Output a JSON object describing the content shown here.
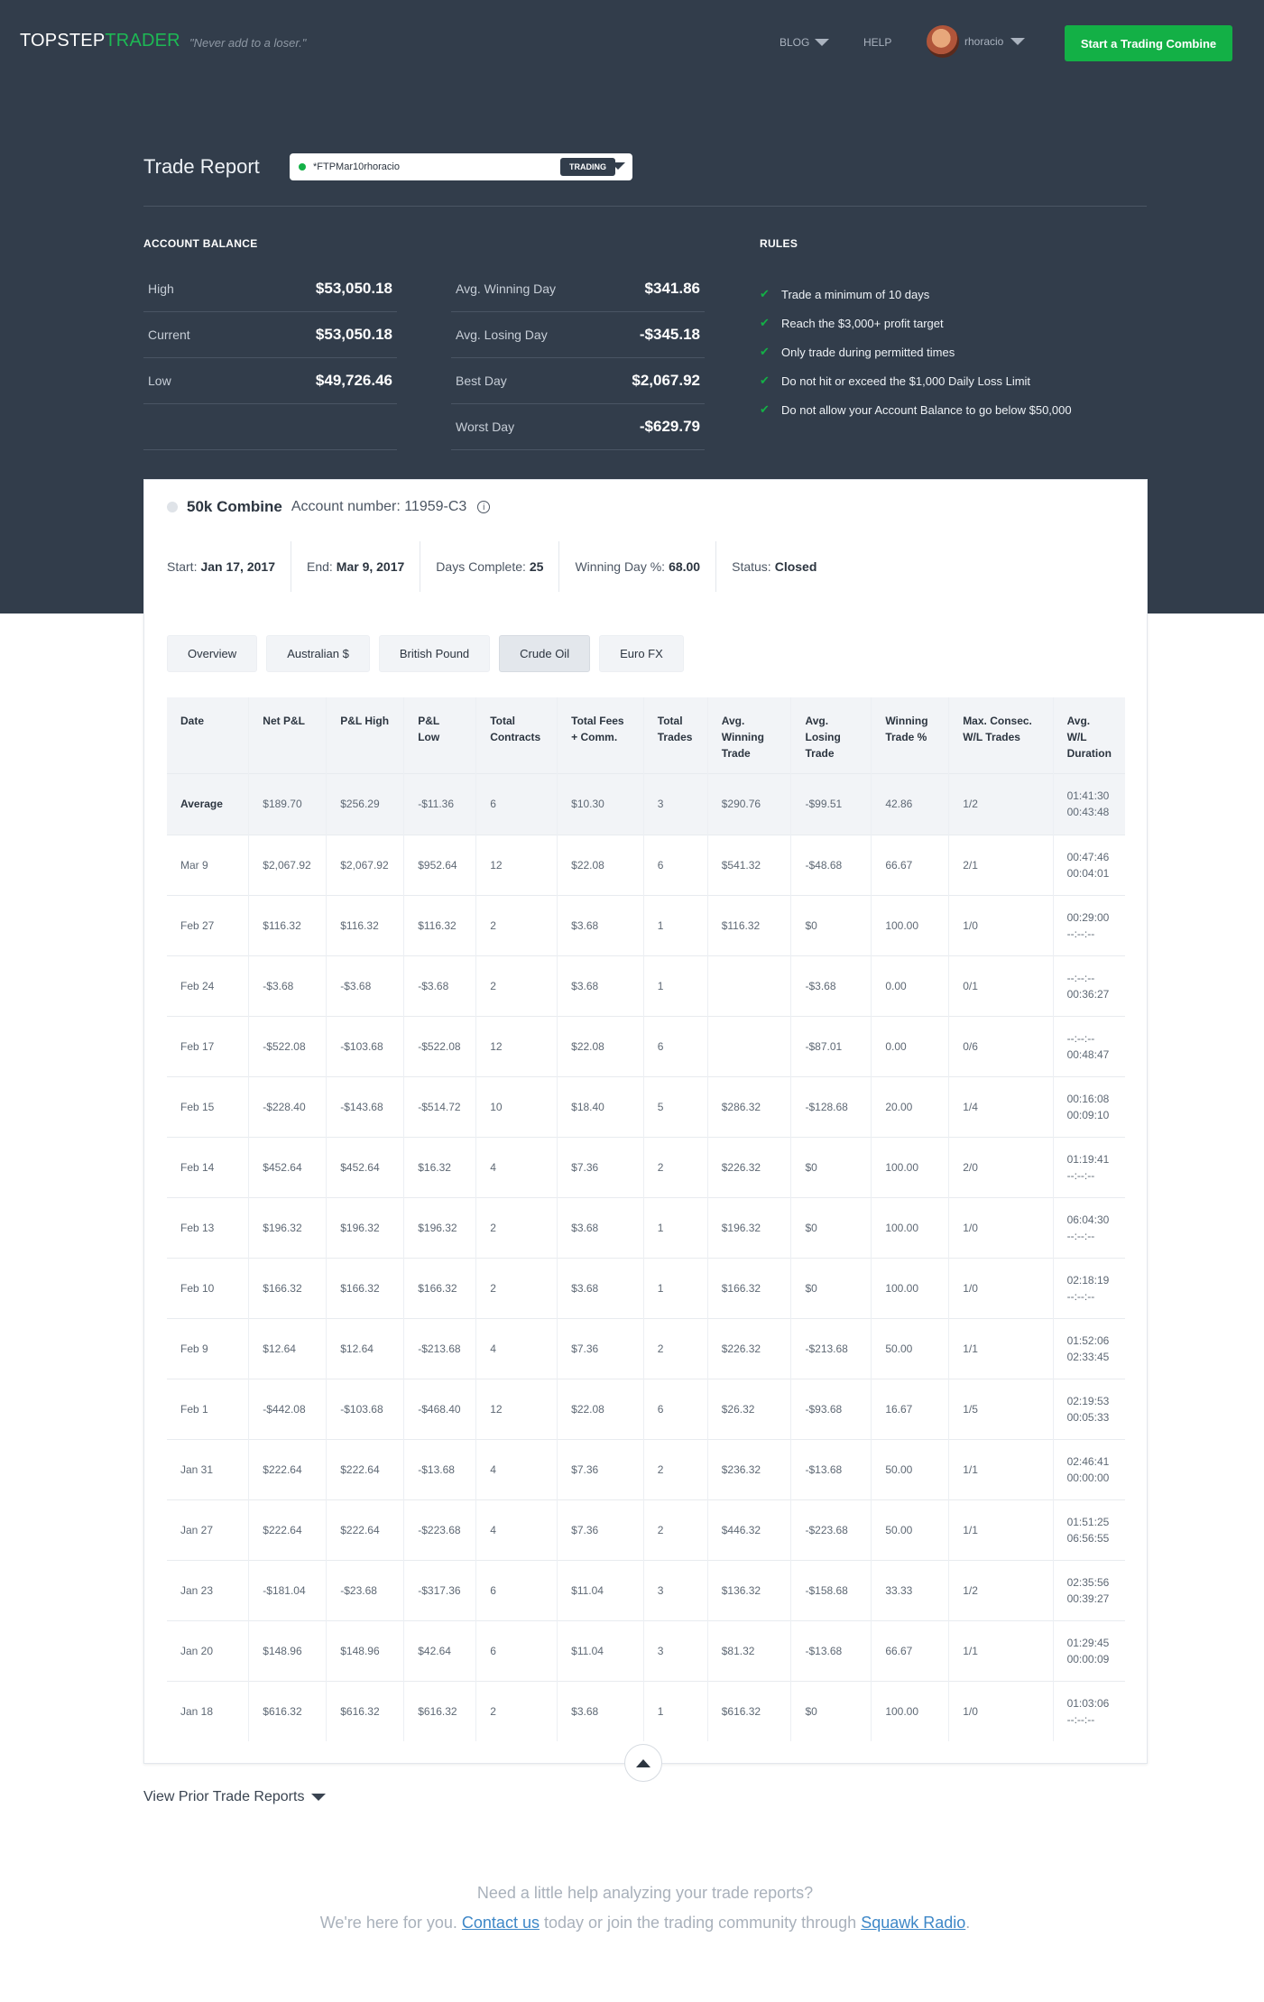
{
  "header": {
    "logo_part1": "TOPSTEP",
    "logo_part2": "TRADER",
    "tagline": "\"Never add to a loser.\"",
    "nav_blog": "BLOG",
    "nav_help": "HELP",
    "username": "rhoracio",
    "cta_label": "Start a Trading Combine"
  },
  "report": {
    "title": "Trade Report",
    "account_value": "*FTPMar10rhoracio",
    "account_badge": "TRADING"
  },
  "balance": {
    "heading": "ACCOUNT BALANCE",
    "col1": [
      {
        "label": "High",
        "value": "$53,050.18"
      },
      {
        "label": "Current",
        "value": "$53,050.18"
      },
      {
        "label": "Low",
        "value": "$49,726.46"
      },
      {
        "label": "",
        "value": ""
      }
    ],
    "col2": [
      {
        "label": "Avg. Winning Day",
        "value": "$341.86"
      },
      {
        "label": "Avg. Losing Day",
        "value": "-$345.18"
      },
      {
        "label": "Best Day",
        "value": "$2,067.92"
      },
      {
        "label": "Worst Day",
        "value": "-$629.79"
      }
    ]
  },
  "rules": {
    "heading": "RULES",
    "items": [
      "Trade a minimum of 10 days",
      "Reach the $3,000+ profit target",
      "Only trade during permitted times",
      "Do not hit or exceed the $1,000 Daily Loss Limit",
      "Do not allow your Account Balance to go below $50,000"
    ]
  },
  "combine": {
    "name": "50k Combine",
    "account_number": "Account number: 11959-C3",
    "start_label": "Start:",
    "start_value": "Jan 17, 2017",
    "end_label": "End:",
    "end_value": "Mar 9, 2017",
    "days_label": "Days Complete:",
    "days_value": "25",
    "winpct_label": "Winning Day %:",
    "winpct_value": "68.00",
    "status_label": "Status:",
    "status_value": "Closed"
  },
  "tabs": [
    "Overview",
    "Australian $",
    "British Pound",
    "Crude Oil",
    "Euro FX"
  ],
  "active_tab": "Crude Oil",
  "table": {
    "headers": [
      [
        "Date"
      ],
      [
        "Net P&L"
      ],
      [
        "P&L High"
      ],
      [
        "P&L",
        "Low"
      ],
      [
        "Total",
        "Contracts"
      ],
      [
        "Total Fees",
        "+ Comm."
      ],
      [
        "Total",
        "Trades"
      ],
      [
        "Avg.",
        "Winning",
        "Trade"
      ],
      [
        "Avg.",
        "Losing",
        "Trade"
      ],
      [
        "Winning",
        "Trade %"
      ],
      [
        "Max. Consec.",
        "W/L Trades"
      ],
      [
        "Avg. W/L",
        "Duration"
      ]
    ],
    "average": [
      "Average",
      "$189.70",
      "$256.29",
      "-$11.36",
      "6",
      "$10.30",
      "3",
      "$290.76",
      "-$99.51",
      "42.86",
      "1/2",
      "01:41:30",
      "00:43:48"
    ],
    "rows": [
      [
        "Mar 9",
        "$2,067.92",
        "$2,067.92",
        "$952.64",
        "12",
        "$22.08",
        "6",
        "$541.32",
        "-$48.68",
        "66.67",
        "2/1",
        "00:47:46",
        "00:04:01"
      ],
      [
        "Feb 27",
        "$116.32",
        "$116.32",
        "$116.32",
        "2",
        "$3.68",
        "1",
        "$116.32",
        "$0",
        "100.00",
        "1/0",
        "00:29:00",
        "--:--:--"
      ],
      [
        "Feb 24",
        "-$3.68",
        "-$3.68",
        "-$3.68",
        "2",
        "$3.68",
        "1",
        "",
        "-$3.68",
        "0.00",
        "0/1",
        "--:--:--",
        "00:36:27"
      ],
      [
        "Feb 17",
        "-$522.08",
        "-$103.68",
        "-$522.08",
        "12",
        "$22.08",
        "6",
        "",
        "-$87.01",
        "0.00",
        "0/6",
        "--:--:--",
        "00:48:47"
      ],
      [
        "Feb 15",
        "-$228.40",
        "-$143.68",
        "-$514.72",
        "10",
        "$18.40",
        "5",
        "$286.32",
        "-$128.68",
        "20.00",
        "1/4",
        "00:16:08",
        "00:09:10"
      ],
      [
        "Feb 14",
        "$452.64",
        "$452.64",
        "$16.32",
        "4",
        "$7.36",
        "2",
        "$226.32",
        "$0",
        "100.00",
        "2/0",
        "01:19:41",
        "--:--:--"
      ],
      [
        "Feb 13",
        "$196.32",
        "$196.32",
        "$196.32",
        "2",
        "$3.68",
        "1",
        "$196.32",
        "$0",
        "100.00",
        "1/0",
        "06:04:30",
        "--:--:--"
      ],
      [
        "Feb 10",
        "$166.32",
        "$166.32",
        "$166.32",
        "2",
        "$3.68",
        "1",
        "$166.32",
        "$0",
        "100.00",
        "1/0",
        "02:18:19",
        "--:--:--"
      ],
      [
        "Feb 9",
        "$12.64",
        "$12.64",
        "-$213.68",
        "4",
        "$7.36",
        "2",
        "$226.32",
        "-$213.68",
        "50.00",
        "1/1",
        "01:52:06",
        "02:33:45"
      ],
      [
        "Feb 1",
        "-$442.08",
        "-$103.68",
        "-$468.40",
        "12",
        "$22.08",
        "6",
        "$26.32",
        "-$93.68",
        "16.67",
        "1/5",
        "02:19:53",
        "00:05:33"
      ],
      [
        "Jan 31",
        "$222.64",
        "$222.64",
        "-$13.68",
        "4",
        "$7.36",
        "2",
        "$236.32",
        "-$13.68",
        "50.00",
        "1/1",
        "02:46:41",
        "00:00:00"
      ],
      [
        "Jan 27",
        "$222.64",
        "$222.64",
        "-$223.68",
        "4",
        "$7.36",
        "2",
        "$446.32",
        "-$223.68",
        "50.00",
        "1/1",
        "01:51:25",
        "06:56:55"
      ],
      [
        "Jan 23",
        "-$181.04",
        "-$23.68",
        "-$317.36",
        "6",
        "$11.04",
        "3",
        "$136.32",
        "-$158.68",
        "33.33",
        "1/2",
        "02:35:56",
        "00:39:27"
      ],
      [
        "Jan 20",
        "$148.96",
        "$148.96",
        "$42.64",
        "6",
        "$11.04",
        "3",
        "$81.32",
        "-$13.68",
        "66.67",
        "1/1",
        "01:29:45",
        "00:00:09"
      ],
      [
        "Jan 18",
        "$616.32",
        "$616.32",
        "$616.32",
        "2",
        "$3.68",
        "1",
        "$616.32",
        "$0",
        "100.00",
        "1/0",
        "01:03:06",
        "--:--:--"
      ]
    ]
  },
  "footer": {
    "prior_reports": "View Prior Trade Reports",
    "help_line1": "Need a little help analyzing your trade reports?",
    "help_line2_a": "We're here for you.",
    "contact_link": "Contact us",
    "help_line2_b": "today or join the trading community through",
    "squawk_link": "Squawk Radio",
    "help_line2_c": "."
  },
  "colors": {
    "header_bg": "#323d4b",
    "accent_green": "#13b046",
    "link_blue": "#3d87c7"
  }
}
